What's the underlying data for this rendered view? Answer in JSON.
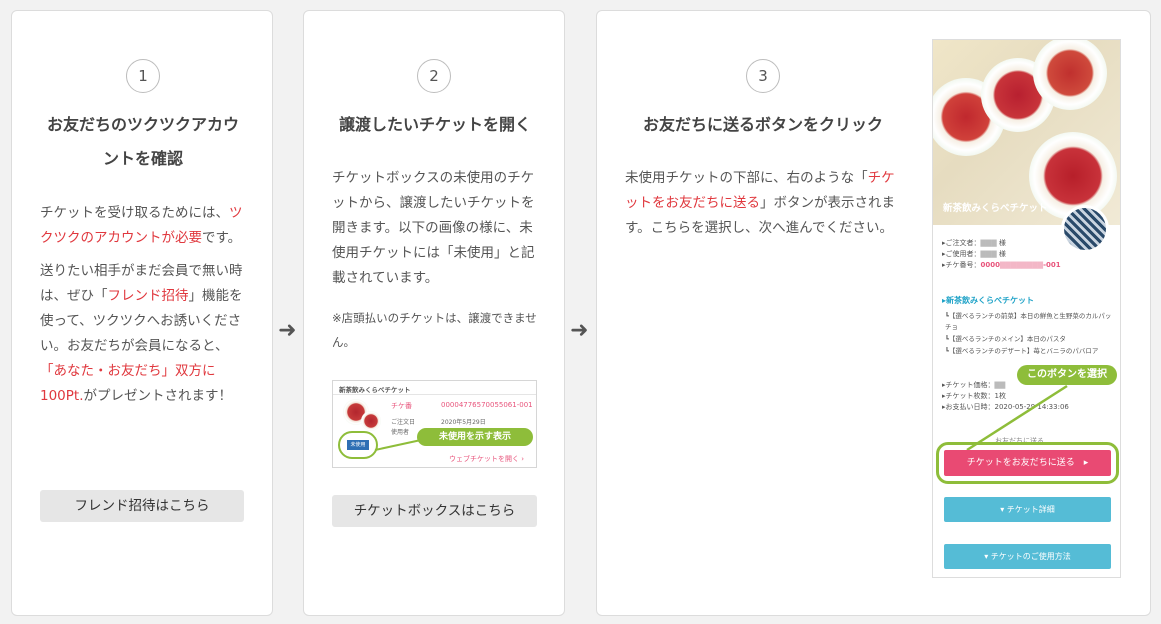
{
  "cards": [
    {
      "number": "1",
      "title_line1": "お友だちのツクツクアカウ",
      "title_line2": "ントを確認",
      "p1_a": "チケットを受け取るためには、",
      "p1_red": "ツクツクのアカウントが必要",
      "p1_b": "です。",
      "p2_a": "送りたい相手がまだ会員で無い時は、ぜひ「",
      "p2_red1": "フレンド招待",
      "p2_b": "」機能を使って、ツクツクへお誘いください。お友だちが会員になると、",
      "p2_red2": "「あなた・お友だち」双方に100Pt.",
      "p2_c": "がプレゼントされます！",
      "button": "フレンド招待はこちら"
    },
    {
      "number": "2",
      "title": "譲渡したいチケットを開く",
      "p1": "チケットボックスの未使用のチケットから、譲渡したいチケットを開きます。以下の画像の様に、未使用チケットには「未使用」と記載されています。",
      "note": "※店頭払いのチケットは、譲渡できません。",
      "image": {
        "head": "新茶飲みくらべチケット",
        "label_ticket": "チケ番",
        "ticket_no": "00004776570055061-001",
        "label_date": "ご注文日",
        "date": "2020年5月29日",
        "label_user": "使用者",
        "badge": "未使用",
        "tag": "未使用を示す表示",
        "link": "ウェブチケットを開く ›"
      },
      "button": "チケットボックスはこちら"
    },
    {
      "number": "3",
      "title": "お友だちに送るボタンをクリック",
      "p1_a": "未使用チケットの下部に、右のような「",
      "p1_red": "チケットをお友だちに送る",
      "p1_b": "」ボタンが表示されます。こちらを選択し、次へ進んでください。",
      "phone": {
        "photo_title": "新茶飲みくらべチケット",
        "row1": "▸ご注文者：",
        "row1_tail": "様",
        "row2": "▸ご使用者：",
        "row2_tail": "様",
        "row3": "▸チケ番号：",
        "row3_val": "0000",
        "row3_tail": "-001",
        "section_title": "▸新茶飲みくらべチケット",
        "menu1": "┗【選べるランチの前菜】本日の鮮魚と生野菜のカルパッチョ",
        "menu2": "┗【選べるランチのメイン】本日のパスタ",
        "menu3": "┗【選べるランチのデザート】苺とバニラのパバロア",
        "price": "▸チケット価格：",
        "count": "▸チケット枚数：1枚",
        "paydate": "▸お支払い日時：2020-05-29 14:33:06",
        "tag": "このボタンを選択",
        "send_label": "お友だちに送る",
        "send_button": "チケットをお友だちに送る　▸",
        "detail_button": "▾ チケット詳細",
        "usage_button": "▾ チケットのご使用方法"
      }
    }
  ],
  "arrows": [
    "➜",
    "➜"
  ]
}
